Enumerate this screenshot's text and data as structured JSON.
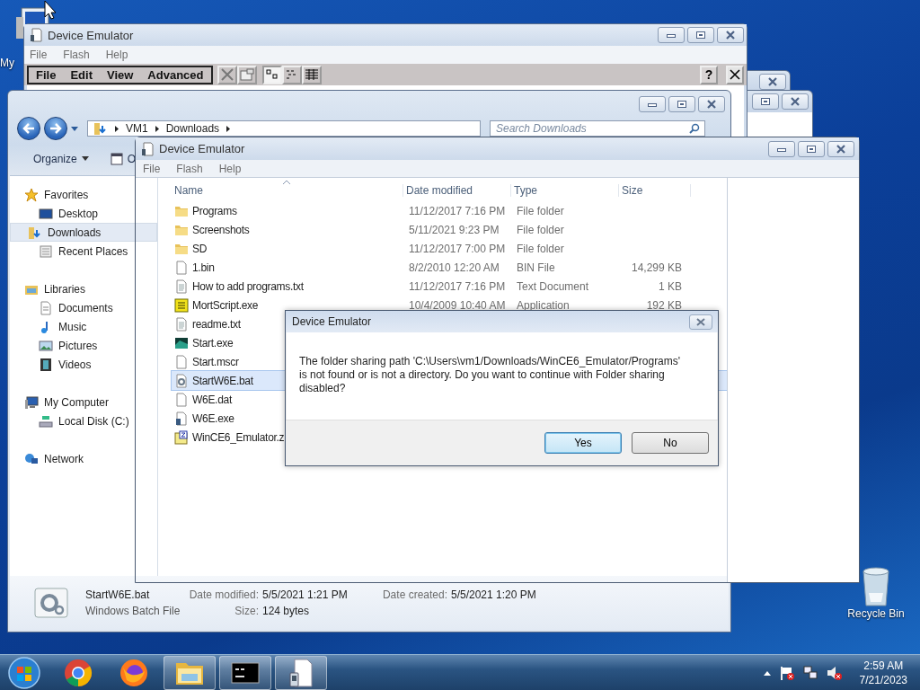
{
  "desktop": {
    "icons": [
      {
        "label": "My",
        "kind": "computer"
      },
      {
        "label": "Recycle Bin",
        "kind": "recycle-bin"
      }
    ]
  },
  "emulator_window": {
    "title": "Device Emulator",
    "menu": [
      "File",
      "Flash",
      "Help"
    ],
    "device_menu": [
      "File",
      "Edit",
      "View",
      "Advanced"
    ],
    "device_toolbar": [
      {
        "kind": "delete",
        "selected": false
      },
      {
        "kind": "properties",
        "selected": false
      },
      {
        "kind": "large-icons",
        "selected": true
      },
      {
        "kind": "list",
        "selected": false
      },
      {
        "kind": "details",
        "selected": false
      }
    ],
    "help_button": "?"
  },
  "explorer": {
    "address": [
      "VM1",
      "Downloads"
    ],
    "search": {
      "placeholder": "Search Downloads"
    },
    "toolbar": [
      {
        "label": "Organize",
        "kind": "menu"
      },
      {
        "label": "O",
        "kind": "command"
      }
    ],
    "sidebar": [
      {
        "label": "Favorites",
        "kind": "star",
        "selected": false,
        "children": [
          {
            "label": "Desktop",
            "kind": "desktop",
            "selected": false
          },
          {
            "label": "Downloads",
            "kind": "downloads",
            "selected": true
          },
          {
            "label": "Recent Places",
            "kind": "recent",
            "selected": false
          }
        ]
      },
      {
        "label": "Libraries",
        "kind": "library",
        "selected": false,
        "children": [
          {
            "label": "Documents",
            "kind": "documents",
            "selected": false
          },
          {
            "label": "Music",
            "kind": "music",
            "selected": false
          },
          {
            "label": "Pictures",
            "kind": "pictures",
            "selected": false
          },
          {
            "label": "Videos",
            "kind": "videos",
            "selected": false
          }
        ]
      },
      {
        "label": "My Computer",
        "kind": "computer",
        "selected": false,
        "children": [
          {
            "label": "Local Disk (C:)",
            "kind": "disk",
            "selected": false
          }
        ]
      },
      {
        "label": "Network",
        "kind": "network",
        "selected": false
      }
    ],
    "columns": [
      "Name",
      "Date modified",
      "Type",
      "Size"
    ],
    "rows": [
      {
        "name": "Programs",
        "kind": "folder",
        "date": "11/12/2017 7:16 PM",
        "type": "File folder",
        "selected": false
      },
      {
        "name": "Screenshots",
        "kind": "folder",
        "date": "5/11/2021 9:23 PM",
        "type": "File folder",
        "selected": false
      },
      {
        "name": "SD",
        "kind": "folder",
        "date": "11/12/2017 7:00 PM",
        "type": "File folder",
        "selected": false
      },
      {
        "name": "1.bin",
        "kind": "file",
        "date": "8/2/2010 12:20 AM",
        "type": "BIN File",
        "size": "14,299 KB",
        "selected": false
      },
      {
        "name": "How to add programs.txt",
        "kind": "text",
        "date": "11/12/2017 7:16 PM",
        "type": "Text Document",
        "size": "1 KB",
        "selected": false
      },
      {
        "name": "MortScript.exe",
        "kind": "script-app",
        "date": "10/4/2009 10:40 AM",
        "type": "Application",
        "size": "192 KB",
        "selected": false
      },
      {
        "name": "readme.txt",
        "kind": "text",
        "selected": false
      },
      {
        "name": "Start.exe",
        "kind": "app",
        "selected": false
      },
      {
        "name": "Start.mscr",
        "kind": "file",
        "selected": false
      },
      {
        "name": "StartW6E.bat",
        "kind": "batch",
        "selected": true
      },
      {
        "name": "W6E.dat",
        "kind": "file",
        "selected": false
      },
      {
        "name": "W6E.exe",
        "kind": "emulator",
        "selected": false
      },
      {
        "name": "WinCE6_Emulator.z",
        "kind": "archive",
        "selected": false
      }
    ],
    "details": {
      "name": "StartW6E.bat",
      "type": "Windows Batch File",
      "fields": [
        {
          "label": "Date modified:",
          "value": "5/5/2021 1:21 PM"
        },
        {
          "label": "Size:",
          "value": "124 bytes"
        },
        {
          "label": "Date created:",
          "value": "5/5/2021 1:20 PM"
        }
      ]
    }
  },
  "front_window": {
    "title": "Device Emulator",
    "menu": [
      "File",
      "Flash",
      "Help"
    ]
  },
  "dialog": {
    "title": "Device Emulator",
    "message": "The folder sharing path 'C:\\Users\\vm1/Downloads/WinCE6_Emulator/Programs' is not found or is not a directory. Do you want to continue with Folder sharing disabled?",
    "buttons": [
      {
        "label": "Yes",
        "default": true
      },
      {
        "label": "No",
        "default": false
      }
    ]
  },
  "taskbar": {
    "apps": [
      {
        "kind": "chrome",
        "active": false
      },
      {
        "kind": "firefox",
        "active": false
      },
      {
        "kind": "explorer",
        "active": true
      },
      {
        "kind": "console",
        "active": true
      },
      {
        "kind": "emulator",
        "active": true
      }
    ],
    "time": "2:59 AM",
    "date": "7/21/2023"
  }
}
